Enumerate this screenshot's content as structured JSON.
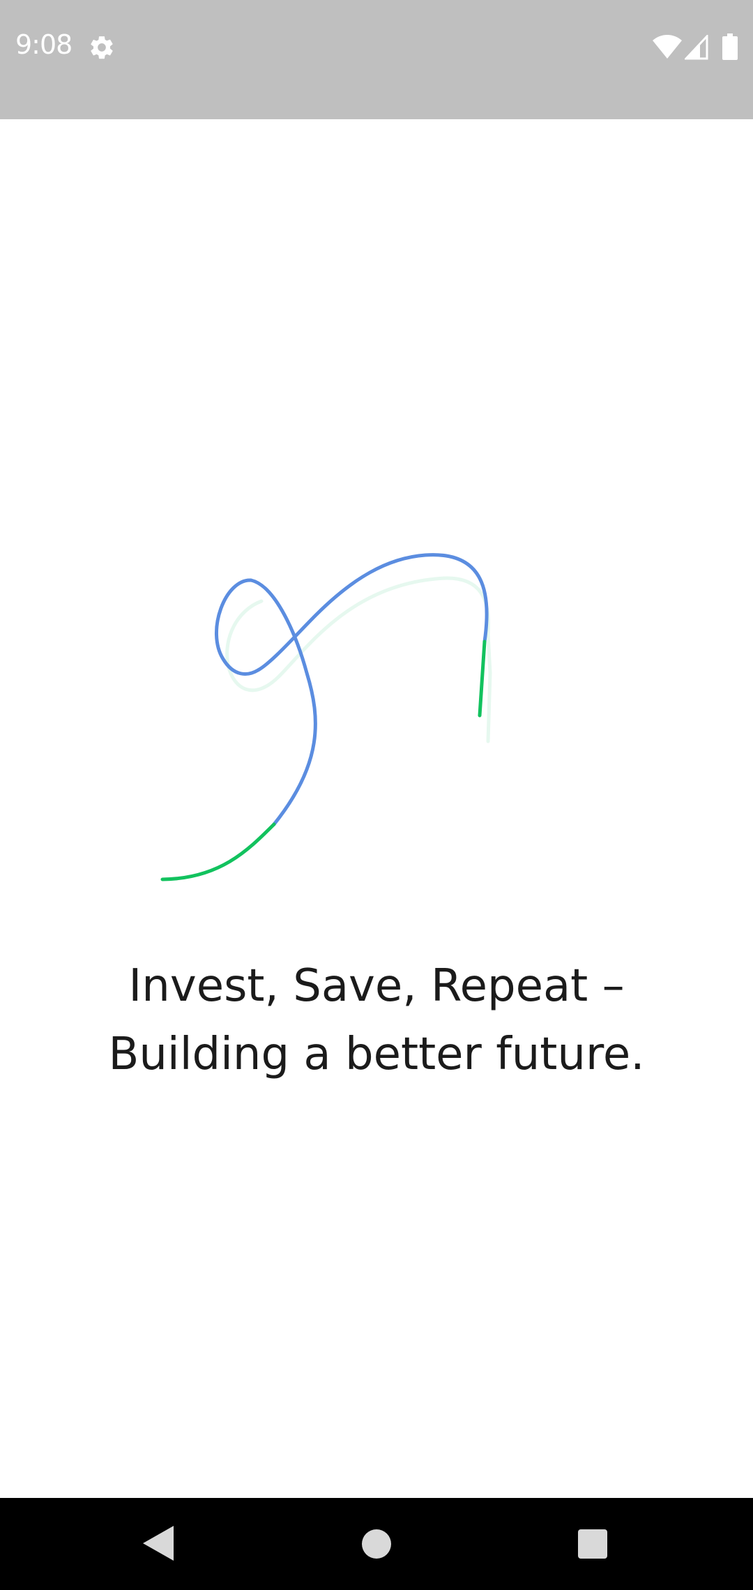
{
  "status_bar": {
    "time": "9:08",
    "icons": [
      "settings-icon",
      "wifi-icon",
      "cell-signal-icon",
      "battery-icon"
    ]
  },
  "splash": {
    "logo": "app-logo",
    "tagline_line1": "Invest, Save, Repeat –",
    "tagline_line2": "Building a better future."
  },
  "colors": {
    "logo_blue": "#5b8de0",
    "logo_green": "#12c25e",
    "logo_shadow": "#e6f8ef",
    "status_bar_bg": "#bfbfbf",
    "nav_bar_bg": "#000000"
  },
  "nav_bar": {
    "buttons": [
      "back-icon",
      "home-icon",
      "recents-icon"
    ]
  }
}
